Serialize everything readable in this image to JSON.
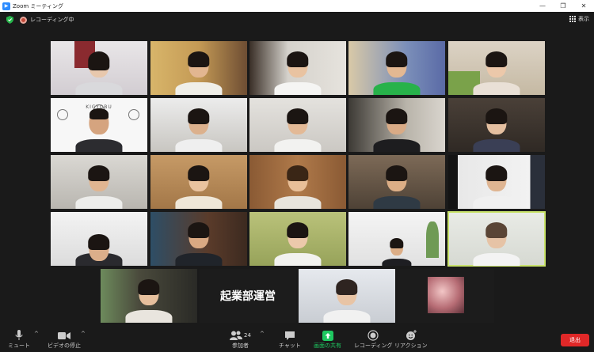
{
  "window": {
    "title": "Zoom ミーティング"
  },
  "topbar": {
    "recording_label": "レコーディング中",
    "view_label": "表示"
  },
  "tiles": {
    "logo_text": "KIGYOBU",
    "name_tile": "起業部運営"
  },
  "toolbar": {
    "mute": "ミュート",
    "stop_video": "ビデオの停止",
    "participants": "参加者",
    "participant_count": "24",
    "chat": "チャット",
    "share_screen": "画面の共有",
    "recording": "レコーディング",
    "reactions": "リアクション",
    "leave": "退出"
  },
  "colors": {
    "share_green": "#1ec760",
    "leave_red": "#e02828",
    "active_speaker": "#c9e36b"
  }
}
